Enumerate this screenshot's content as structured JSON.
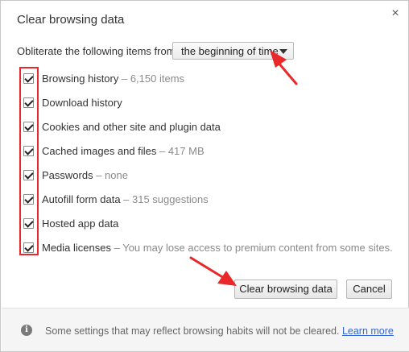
{
  "dialog": {
    "title": "Clear browsing data",
    "close_glyph": "×"
  },
  "time_range": {
    "label": "Obliterate the following items from:",
    "selected": "the beginning of time"
  },
  "items": [
    {
      "label": "Browsing history",
      "detail": " – 6,150 items",
      "checked": true
    },
    {
      "label": "Download history",
      "detail": "",
      "checked": true
    },
    {
      "label": "Cookies and other site and plugin data",
      "detail": "",
      "checked": true
    },
    {
      "label": "Cached images and files",
      "detail": " – 417 MB",
      "checked": true
    },
    {
      "label": "Passwords",
      "detail": " – none",
      "checked": true
    },
    {
      "label": "Autofill form data",
      "detail": " – 315 suggestions",
      "checked": true
    },
    {
      "label": "Hosted app data",
      "detail": "",
      "checked": true
    },
    {
      "label": "Media licenses",
      "detail": " – You may lose access to premium content from some sites.",
      "checked": true
    }
  ],
  "buttons": {
    "clear": "Clear browsing data",
    "cancel": "Cancel"
  },
  "footer": {
    "icon": "i",
    "text": "Some settings that may reflect browsing habits will not be cleared.",
    "link": "Learn more"
  },
  "annotation_color": "#e8282b"
}
